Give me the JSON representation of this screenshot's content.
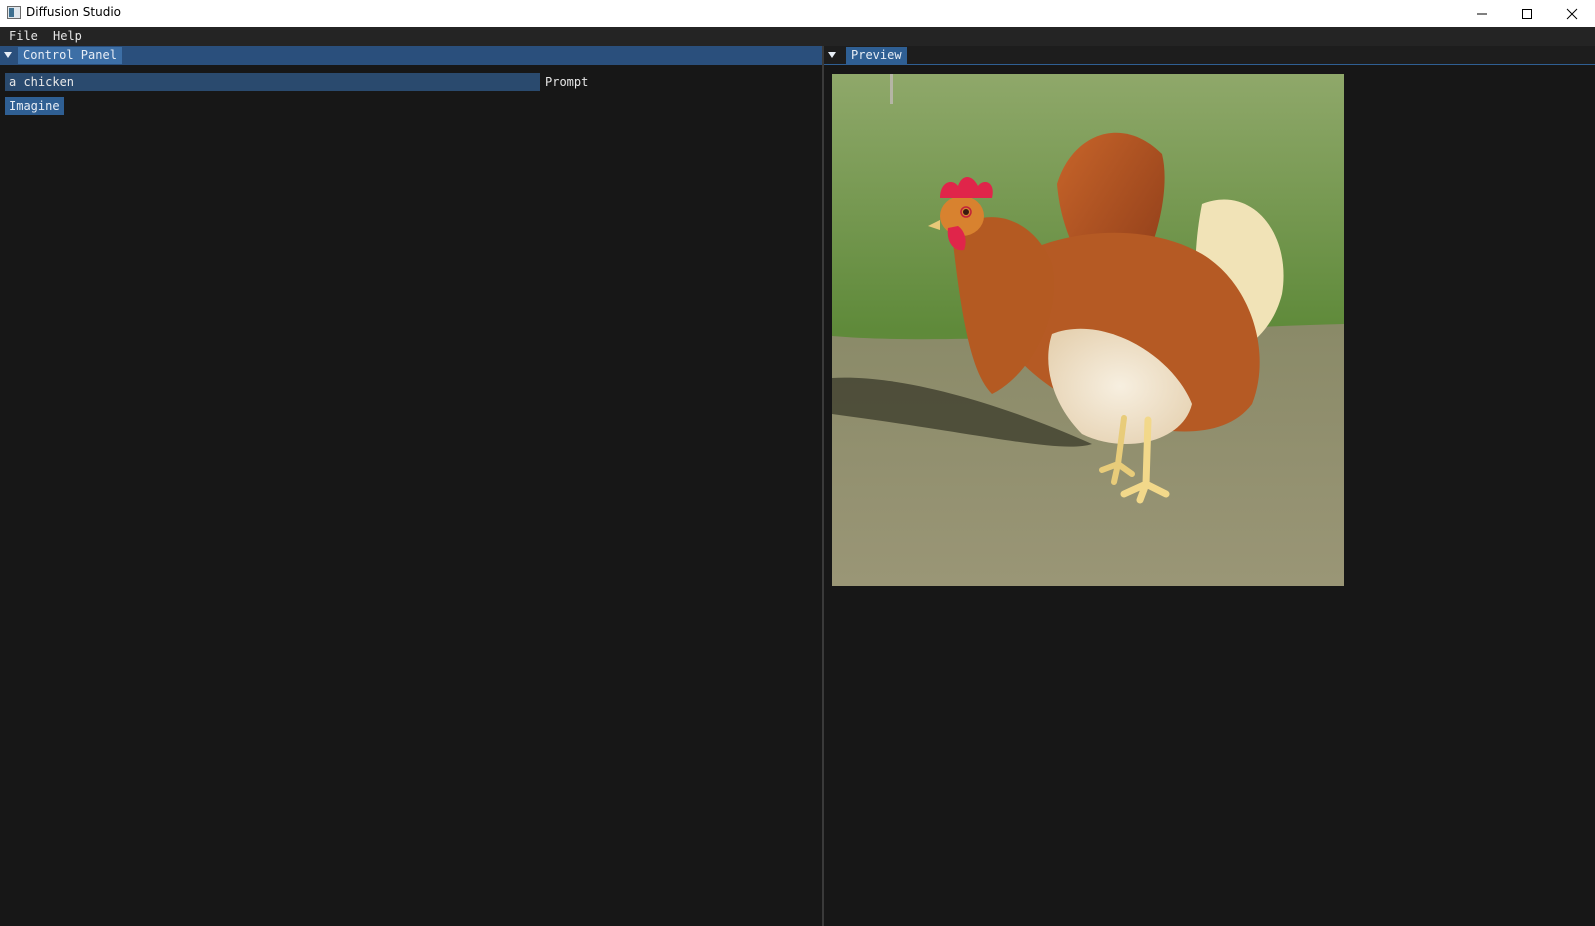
{
  "window": {
    "title": "Diffusion Studio",
    "icon": "app-window-icon",
    "controls": [
      "minimize-icon",
      "maximize-icon",
      "close-icon"
    ]
  },
  "menubar": {
    "items": [
      {
        "label": "File"
      },
      {
        "label": "Help"
      }
    ]
  },
  "control_panel": {
    "tab_label": "Control Panel",
    "collapse_icon": "collapse-triangle-icon",
    "prompt": {
      "value": "a chicken",
      "label": "Prompt"
    },
    "imagine_button": "Imagine"
  },
  "preview_panel": {
    "tab_label": "Preview",
    "collapse_icon": "collapse-triangle-icon",
    "image": "generated image of a rooster standing on pavement beside grass"
  },
  "colors": {
    "window_bg": "#171717",
    "menubar_bg": "#242424",
    "accent": "#2f5f93",
    "active_tab": "#3d6fa6",
    "input_bg": "#2a4a6e"
  }
}
